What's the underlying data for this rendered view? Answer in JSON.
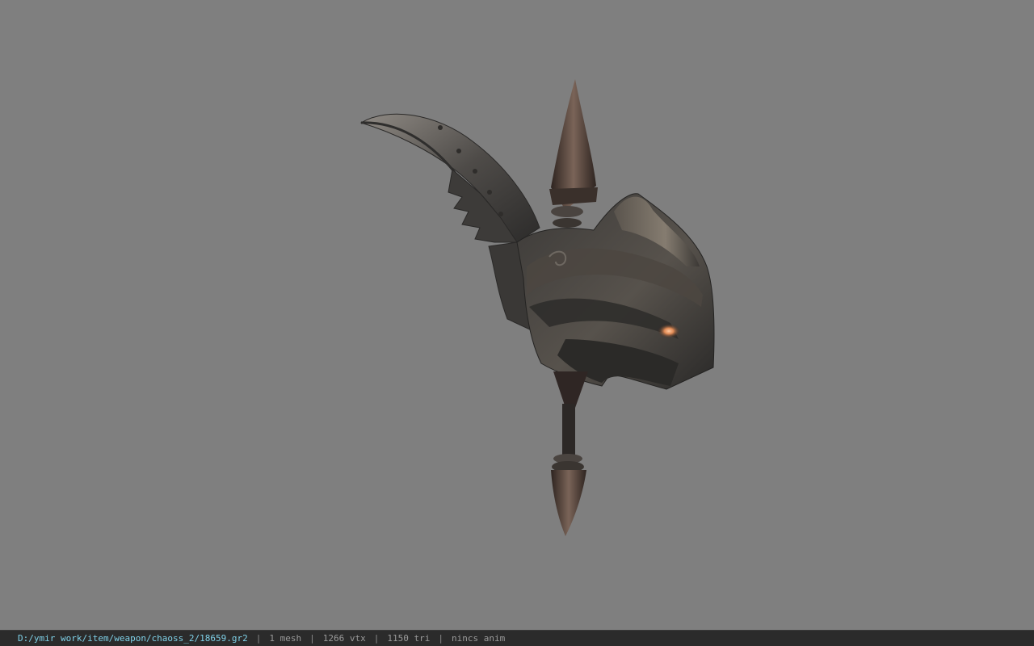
{
  "viewer": {
    "background_color": "#7f7f7f",
    "model": {
      "name": "chaos-axe-weapon-model",
      "colors": {
        "metal_dark": "#3a3835",
        "metal_mid": "#5c5650",
        "metal_light": "#8d867c",
        "spike": "#4a3a32",
        "glow": "#e08a55"
      }
    }
  },
  "statusbar": {
    "file_path": "D:/ymir work/item/weapon/chaoss_2/18659.gr2",
    "separator": "|",
    "mesh_count": "1 mesh",
    "vertex_count": "1266 vtx",
    "triangle_count": "1150 tri",
    "anim_status": "nincs anim"
  }
}
